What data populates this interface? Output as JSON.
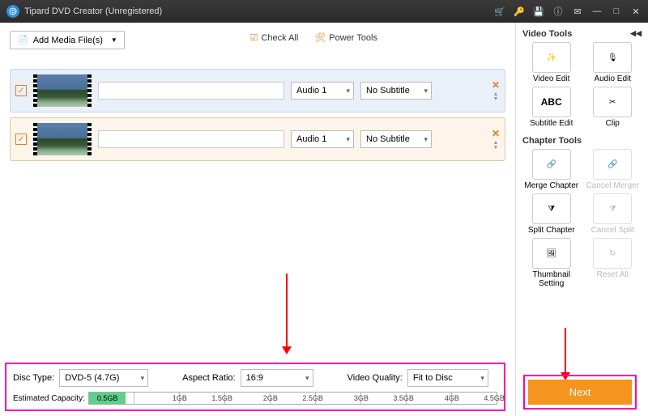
{
  "title": "Tipard DVD Creator (Unregistered)",
  "toolbar": {
    "addMedia": "Add Media File(s)",
    "checkAll": "Check All",
    "powerTools": "Power Tools"
  },
  "items": [
    {
      "audio": "Audio 1",
      "subtitle": "No Subtitle"
    },
    {
      "audio": "Audio 1",
      "subtitle": "No Subtitle"
    }
  ],
  "bottom": {
    "discTypeLabel": "Disc Type:",
    "discType": "DVD-5 (4.7G)",
    "aspectLabel": "Aspect Ratio:",
    "aspect": "16:9",
    "qualityLabel": "Video Quality:",
    "quality": "Fit to Disc",
    "capacityLabel": "Estimated Capacity:",
    "capFill": "0.5GB",
    "ticks": [
      "1GB",
      "1.5GB",
      "2GB",
      "2.5GB",
      "3GB",
      "3.5GB",
      "4GB",
      "4.5GB"
    ]
  },
  "sidebar": {
    "videoTools": "Video Tools",
    "chapterTools": "Chapter Tools",
    "tools": {
      "videoEdit": "Video Edit",
      "audioEdit": "Audio Edit",
      "abc": "ABC",
      "subtitleEdit": "Subtitle Edit",
      "clip": "Clip",
      "mergeChapter": "Merge Chapter",
      "cancelMerger": "Cancel Merger",
      "splitChapter": "Split Chapter",
      "cancelSplit": "Cancel Split",
      "thumbnailSetting": "Thumbnail Setting",
      "resetAll": "Reset All"
    }
  },
  "next": "Next"
}
